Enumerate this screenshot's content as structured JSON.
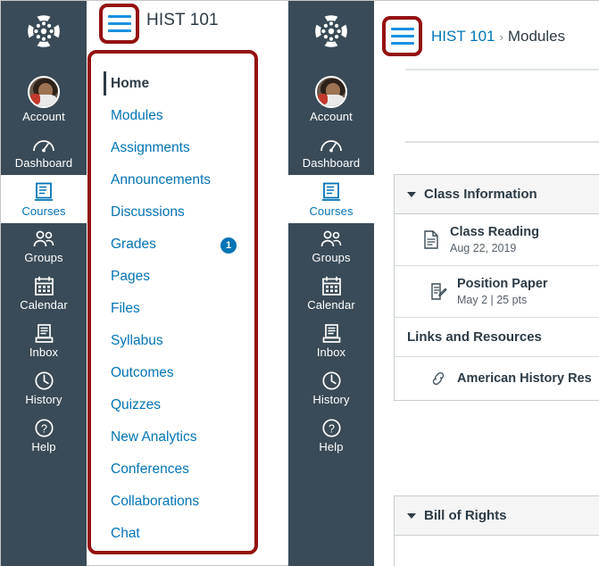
{
  "global_nav": {
    "logo_icon": "canvas-logo-icon",
    "items": [
      {
        "label": "Account",
        "icon": "avatar-icon",
        "active": false
      },
      {
        "label": "Dashboard",
        "icon": "dashboard-speedometer-icon",
        "active": false
      },
      {
        "label": "Courses",
        "icon": "courses-book-icon",
        "active": true
      },
      {
        "label": "Groups",
        "icon": "groups-people-icon",
        "active": false
      },
      {
        "label": "Calendar",
        "icon": "calendar-icon",
        "active": false
      },
      {
        "label": "Inbox",
        "icon": "inbox-tray-icon",
        "active": false
      },
      {
        "label": "History",
        "icon": "history-clock-icon",
        "active": false
      },
      {
        "label": "Help",
        "icon": "help-question-icon",
        "active": false
      }
    ]
  },
  "left_panel": {
    "menu_toggle_icon": "hamburger-menu-icon",
    "course_title": "HIST 101",
    "course_nav": {
      "items": [
        {
          "label": "Home",
          "active": true,
          "badge": ""
        },
        {
          "label": "Modules",
          "active": false,
          "badge": ""
        },
        {
          "label": "Assignments",
          "active": false,
          "badge": ""
        },
        {
          "label": "Announcements",
          "active": false,
          "badge": ""
        },
        {
          "label": "Discussions",
          "active": false,
          "badge": ""
        },
        {
          "label": "Grades",
          "active": false,
          "badge": "1"
        },
        {
          "label": "Pages",
          "active": false,
          "badge": ""
        },
        {
          "label": "Files",
          "active": false,
          "badge": ""
        },
        {
          "label": "Syllabus",
          "active": false,
          "badge": ""
        },
        {
          "label": "Outcomes",
          "active": false,
          "badge": ""
        },
        {
          "label": "Quizzes",
          "active": false,
          "badge": ""
        },
        {
          "label": "New Analytics",
          "active": false,
          "badge": ""
        },
        {
          "label": "Conferences",
          "active": false,
          "badge": ""
        },
        {
          "label": "Collaborations",
          "active": false,
          "badge": ""
        },
        {
          "label": "Chat",
          "active": false,
          "badge": ""
        }
      ]
    }
  },
  "right_panel": {
    "menu_toggle_icon": "hamburger-menu-icon",
    "breadcrumb": {
      "course": "HIST 101",
      "separator": "›",
      "current": "Modules"
    },
    "modules": [
      {
        "title": "Class Information",
        "collapse_icon": "caret-down-icon",
        "rows": [
          {
            "kind": "item",
            "icon": "document-page-icon",
            "title": "Class Reading",
            "subtitle": "Aug 22, 2019",
            "indent": 1
          },
          {
            "kind": "item",
            "icon": "assignment-edit-icon",
            "title": "Position Paper",
            "subtitle": "May 2  |  25 pts",
            "indent": 2
          },
          {
            "kind": "subheader",
            "title": "Links and Resources"
          },
          {
            "kind": "item",
            "icon": "link-chain-icon",
            "title": "American History Res",
            "subtitle": "",
            "indent": 2
          }
        ]
      },
      {
        "title": "Bill of Rights",
        "collapse_icon": "caret-down-icon",
        "rows": []
      }
    ]
  },
  "colors": {
    "nav_background": "#394B58",
    "link_blue": "#0374B5",
    "highlight_red": "#941010",
    "text_dark": "#2D3B45",
    "badge_blue": "#0374B5",
    "burger_line_blue": "#1790DF",
    "module_header_bg": "#F5F5F5"
  }
}
